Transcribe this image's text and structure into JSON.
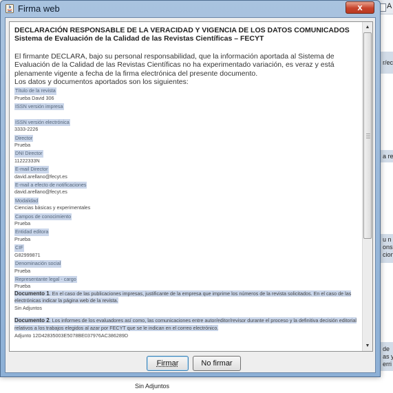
{
  "window": {
    "title": "Firma web",
    "close_symbol": "x"
  },
  "background": {
    "tab_label": "A",
    "fragments": [
      "r/ec",
      "a re",
      "u n",
      "ons",
      "cion",
      "de",
      "as y",
      "erri"
    ],
    "below_text": "Sin Adjuntos"
  },
  "document": {
    "heading1": "DECLARACIÓN RESPONSABLE DE LA VERACIDAD Y VIGENCIA DE LOS DATOS COMUNICADOS",
    "heading2": "Sistema de Evaluación de la Calidad de las Revistas Científicas – FECYT",
    "paragraph1": "El firmante DECLARA, bajo su personal responsabilidad, que la información aportada al Sistema de Evaluación de la Calidad de las Revistas Científicas no ha experimentado variación, es veraz y está plenamente vigente a fecha de la firma electrónica del presente documento.",
    "paragraph2": "Los datos y documentos aportados son los siguientes:",
    "fields": [
      {
        "label": "Título de la revista",
        "value": "Prueba David 306"
      },
      {
        "label": "ISSN versión impresa",
        "value": ""
      },
      {
        "label": "ISSN versión electrónica",
        "value": "3333-2226"
      },
      {
        "label": "Director",
        "value": "Prueba"
      },
      {
        "label": "DNI Director",
        "value": "11222333N"
      },
      {
        "label": "E-mail Director",
        "value": "david.arellano@fecyt.es"
      },
      {
        "label": "E-mail a efecto de notificaciones",
        "value": "david.arellano@fecyt.es"
      },
      {
        "label": "Modalidad",
        "value": "Ciencias básicas y experimentales"
      },
      {
        "label": "Campos de conocimiento",
        "value": "Prueba"
      },
      {
        "label": "Entidad editora",
        "value": "Prueba"
      },
      {
        "label": "CIF",
        "value": "G82999871"
      },
      {
        "label": "Denominación social",
        "value": "Prueba"
      },
      {
        "label": "Representante legal - cargo",
        "value": "Prueba"
      }
    ],
    "doc1_title": "Documento 1",
    "doc1_text": ". En el caso de las publicaciones impresas, justificante de la empresa que imprime los números de la revista solicitados. En el caso de las electrónicas indicar la página web de la revista.",
    "doc1_value": "Sin Adjuntos",
    "doc2_title": "Documento 2",
    "doc2_text": ". Los informes de los evaluadores así como, las comunicaciones entre autor/editor/revisor durante el proceso y la definitiva decisión editorial relativos a los trabajos elegidos al azar por FECYT que se le indican en el correo electrónico.",
    "doc2_value": "Adjunto 12D42835003E5078BE037976AC386289D"
  },
  "buttons": {
    "sign": "Firmar",
    "no_sign": "No firmar"
  }
}
